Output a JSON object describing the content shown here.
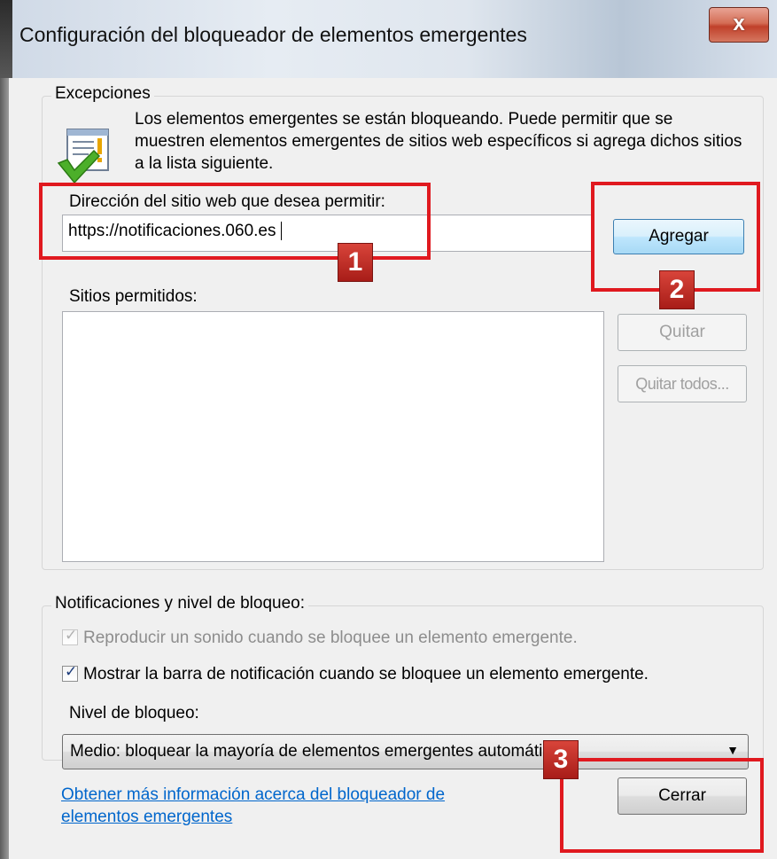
{
  "window": {
    "title": "Configuración del bloqueador de elementos emergentes",
    "close_label": "x"
  },
  "exceptions": {
    "group_title": "Excepciones",
    "info_text": "Los elementos emergentes se están bloqueando. Puede permitir que se muestren elementos emergentes de sitios web específicos si agrega dichos sitios a la lista siguiente.",
    "address_label": "Dirección del sitio web que desea permitir:",
    "address_value": "https://notificaciones.060.es",
    "add_button": "Agregar",
    "allowed_sites_label": "Sitios permitidos:",
    "allowed_sites": [],
    "remove_button": "Quitar",
    "remove_all_button": "Quitar todos..."
  },
  "notifications": {
    "group_title": "Notificaciones y nivel de bloqueo:",
    "play_sound": {
      "label": "Reproducir un sonido cuando se bloquee un elemento emergente.",
      "checked": true,
      "enabled": false
    },
    "show_bar": {
      "label": "Mostrar la barra de notificación cuando se bloquee un elemento emergente.",
      "checked": true,
      "enabled": true
    },
    "level_label": "Nivel de bloqueo:",
    "level_value": "Medio: bloquear la mayoría de elementos emergentes automáticos"
  },
  "footer": {
    "help_link": "Obtener más información acerca del bloqueador de elementos emergentes",
    "close_button": "Cerrar"
  },
  "annotations": {
    "badge_1": "1",
    "badge_2": "2",
    "badge_3": "3",
    "color": "#e0191f"
  },
  "colors": {
    "link": "#0066cc",
    "accent_button_border": "#3c7fb1"
  }
}
